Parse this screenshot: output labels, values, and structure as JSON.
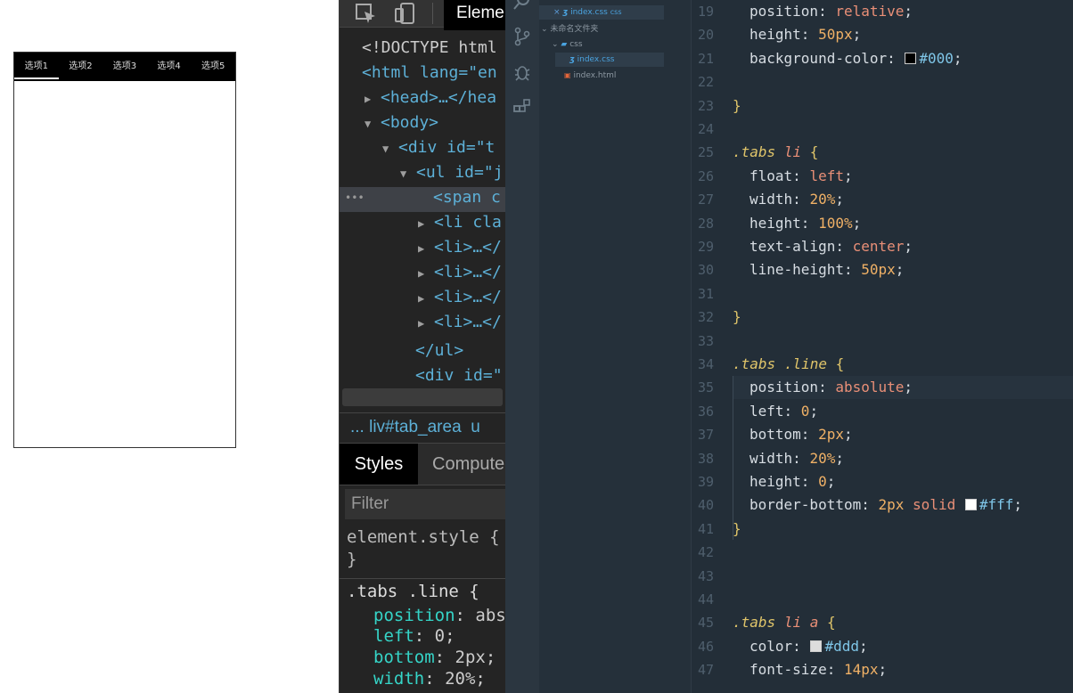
{
  "preview": {
    "tabs": [
      "选项1",
      "选项2",
      "选项3",
      "选项4",
      "选项5"
    ],
    "active_tab_index": 0
  },
  "devtools": {
    "active_tab": "Eleme",
    "tree": [
      {
        "text": "<!DOCTYPE html"
      },
      {
        "text": "<html lang=\"en"
      },
      {
        "text": "<head>…</hea"
      },
      {
        "text": "<body>"
      },
      {
        "text": "<div id=\"t"
      },
      {
        "text": "<ul id=\"j"
      },
      {
        "text": "<span c"
      },
      {
        "text": "<li cla"
      },
      {
        "text": "<li>…</"
      },
      {
        "text": "<li>…</"
      },
      {
        "text": "<li>…</"
      },
      {
        "text": "<li>…</"
      },
      {
        "text": "</ul>"
      },
      {
        "text": "<div id=\""
      }
    ],
    "selected_dots": "•••",
    "breadcrumb": "... liv#tab_area  u",
    "panel_tabs": {
      "styles": "Styles",
      "computed": "Compute"
    },
    "filter_placeholder": "Filter",
    "element_style": {
      "selector": "element.style {",
      "close": "}"
    },
    "rule": {
      "selector": ".tabs .line {",
      "props": [
        {
          "name": "position",
          "value": "abs"
        },
        {
          "name": "left",
          "value": "0;"
        },
        {
          "name": "bottom",
          "value": "2px;"
        },
        {
          "name": "width",
          "value": "20%;"
        }
      ]
    }
  },
  "explorer": {
    "rows": [
      {
        "label": "index.css",
        "suffix": "css",
        "kind": "open-file"
      },
      {
        "label": "未命名文件夹",
        "kind": "folder"
      },
      {
        "label": "css",
        "kind": "subfolder"
      },
      {
        "label": "index.css",
        "kind": "css-file"
      },
      {
        "label": "index.html",
        "kind": "html-file"
      }
    ]
  },
  "editor": {
    "lines": [
      {
        "n": "19",
        "text": "position: relative;"
      },
      {
        "n": "20",
        "text": "height: 50px;"
      },
      {
        "n": "21",
        "text": "background-color: #000;"
      },
      {
        "n": "22",
        "text": ""
      },
      {
        "n": "23",
        "text": "}"
      },
      {
        "n": "24",
        "text": ""
      },
      {
        "n": "25",
        "text": ".tabs li {"
      },
      {
        "n": "26",
        "text": "float: left;"
      },
      {
        "n": "27",
        "text": "width: 20%;"
      },
      {
        "n": "28",
        "text": "height: 100%;"
      },
      {
        "n": "29",
        "text": "text-align: center;"
      },
      {
        "n": "30",
        "text": "line-height: 50px;"
      },
      {
        "n": "31",
        "text": ""
      },
      {
        "n": "32",
        "text": "}"
      },
      {
        "n": "33",
        "text": ""
      },
      {
        "n": "34",
        "text": ".tabs .line {"
      },
      {
        "n": "35",
        "text": "position: absolute;"
      },
      {
        "n": "36",
        "text": "left: 0;"
      },
      {
        "n": "37",
        "text": "bottom: 2px;"
      },
      {
        "n": "38",
        "text": "width: 20%;"
      },
      {
        "n": "39",
        "text": "height: 0;"
      },
      {
        "n": "40",
        "text": "border-bottom: 2px solid #fff;"
      },
      {
        "n": "41",
        "text": "}"
      },
      {
        "n": "42",
        "text": ""
      },
      {
        "n": "43",
        "text": ""
      },
      {
        "n": "44",
        "text": ""
      },
      {
        "n": "45",
        "text": ".tabs li a {"
      },
      {
        "n": "46",
        "text": "color: #ddd;"
      },
      {
        "n": "47",
        "text": "font-size: 14px;"
      }
    ]
  },
  "colors": {
    "swatch_000": "#000000",
    "swatch_fff": "#ffffff",
    "swatch_ddd": "#dddddd"
  }
}
